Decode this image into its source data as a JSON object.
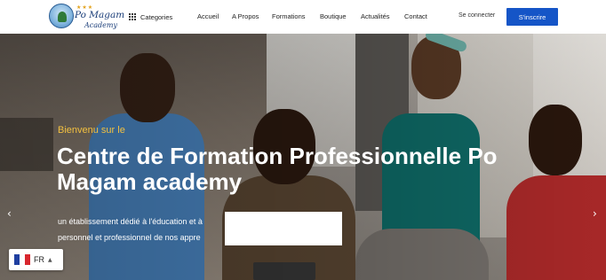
{
  "header": {
    "logo": {
      "name": "Po Magam",
      "sub": "Academy",
      "stars": "★★★"
    },
    "categories_label": "Categories",
    "nav": [
      "Accueil",
      "A Propos",
      "Formations",
      "Boutique",
      "Actualités",
      "Contact"
    ],
    "signin_label": "Se connecter",
    "register_label": "S'inscrire"
  },
  "hero": {
    "welcome": "Bienvenu sur le",
    "headline": "Centre de Formation Professionnelle Po Magam academy",
    "description_line1": "un établissement dédié à l'éducation et à",
    "description_line2": "personnel et professionnel de nos appre",
    "prev_icon": "chevron-left-icon",
    "next_icon": "chevron-right-icon"
  },
  "language": {
    "code": "FR",
    "flag_colors": [
      "#1f3fa0",
      "#ffffff",
      "#d8262e"
    ]
  },
  "colors": {
    "accent": "#1555c7",
    "welcome": "#f2c040"
  }
}
